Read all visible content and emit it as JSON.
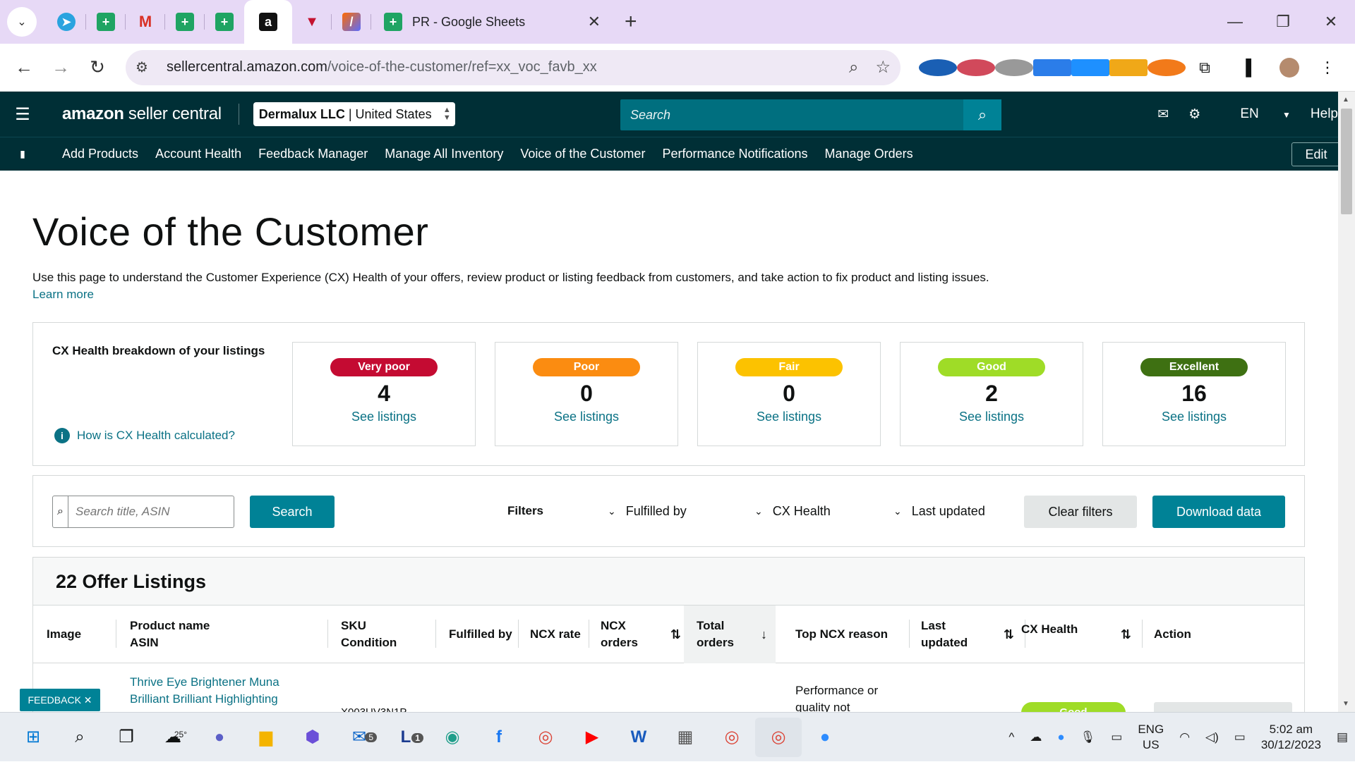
{
  "browser": {
    "active_tab_title": "PR - Google Sheets",
    "url_host": "sellercentral.amazon.com",
    "url_path": "/voice-of-the-customer/ref=xx_voc_favb_xx",
    "tab_icons": [
      "telegram-icon",
      "sheets-icon",
      "gmail-icon",
      "sheets-icon",
      "sheets-icon",
      "amazon-icon",
      "helium-icon",
      "zapier-icon"
    ]
  },
  "header": {
    "logo_bold": "amazon",
    "logo_rest": " seller central",
    "account_name": "Dermalux LLC",
    "account_sep": " | ",
    "account_region": "United States",
    "search_placeholder": "Search",
    "lang": "EN",
    "help": "Help"
  },
  "nav": {
    "items": [
      "Add Products",
      "Account Health",
      "Feedback Manager",
      "Manage All Inventory",
      "Voice of the Customer",
      "Performance Notifications",
      "Manage Orders"
    ],
    "edit": "Edit"
  },
  "page": {
    "title": "Voice of the Customer",
    "intro": "Use this page to understand the Customer Experience (CX) Health of your offers, review product or listing feedback from customers, and take action to fix product and listing issues.",
    "learn_more": "Learn more"
  },
  "cx": {
    "label": "CX Health breakdown of your listings",
    "how": "How is CX Health calculated?",
    "cards": [
      {
        "badge": "Very poor",
        "count": "4",
        "link": "See listings",
        "color": "#c40b32"
      },
      {
        "badge": "Poor",
        "count": "0",
        "link": "See listings",
        "color": "#fb8c11"
      },
      {
        "badge": "Fair",
        "count": "0",
        "link": "See listings",
        "color": "#fcc200"
      },
      {
        "badge": "Good",
        "count": "2",
        "link": "See listings",
        "color": "#9fdc27"
      },
      {
        "badge": "Excellent",
        "count": "16",
        "link": "See listings",
        "color": "#3e7012"
      }
    ]
  },
  "filters": {
    "search_placeholder": "Search title, ASIN",
    "search_button": "Search",
    "label": "Filters",
    "fulfilled_by": "Fulfilled by",
    "cx_health": "CX Health",
    "last_updated": "Last updated",
    "clear": "Clear filters",
    "download": "Download data"
  },
  "listings": {
    "heading": "22 Offer Listings",
    "columns": {
      "image": "Image",
      "product_name": "Product name",
      "asin": "ASIN",
      "sku": "SKU",
      "condition": "Condition",
      "fulfilled_by": "Fulfilled by",
      "ncx_rate": "NCX rate",
      "ncx_orders_1": "NCX",
      "ncx_orders_2": "orders",
      "total_orders_1": "Total",
      "total_orders_2": "orders",
      "top_ncx_reason": "Top NCX reason",
      "last_updated_1": "Last",
      "last_updated_2": "updated",
      "cx_health": "CX Health",
      "action": "Action"
    },
    "row1": {
      "product_line1": "Thrive Eye Brightener Muna",
      "product_line2": "Brilliant Brilliant Highlighting",
      "sku_partial": "X003UV3N1P",
      "reason_line1": "Performance or",
      "reason_line2": "quality not",
      "health": "Good"
    }
  },
  "feedback": "FEEDBACK ✕",
  "taskbar": {
    "weather": "25°",
    "mail_badge": "5",
    "l_badge": "1",
    "lang1": "ENG",
    "lang2": "US",
    "time": "5:02 am",
    "date": "30/12/2023"
  }
}
